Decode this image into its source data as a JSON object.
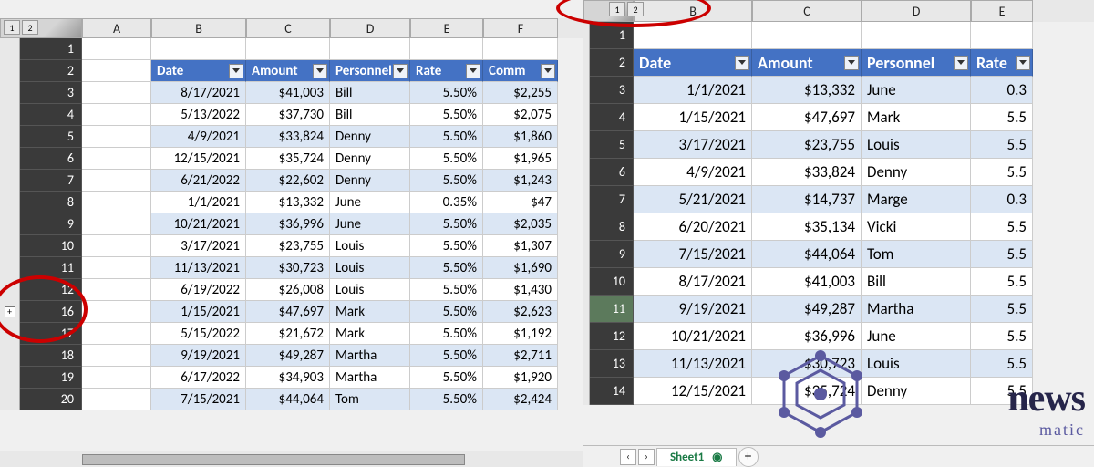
{
  "outline_levels": [
    "1",
    "2"
  ],
  "left": {
    "columns": [
      "A",
      "B",
      "C",
      "D",
      "E",
      "F"
    ],
    "row_numbers": [
      "1",
      "2",
      "3",
      "4",
      "5",
      "6",
      "7",
      "8",
      "9",
      "10",
      "11",
      "12",
      "16",
      "17",
      "18",
      "19",
      "20"
    ],
    "expand_row_index": 12,
    "headers": {
      "date": "Date",
      "amount": "Amount",
      "personnel": "Personnel",
      "rate": "Rate",
      "comm": "Comm"
    },
    "rows": [
      {
        "date": "8/17/2021",
        "amount": "$41,003",
        "personnel": "Bill",
        "rate": "5.50%",
        "comm": "$2,255"
      },
      {
        "date": "5/13/2022",
        "amount": "$37,730",
        "personnel": "Bill",
        "rate": "5.50%",
        "comm": "$2,075"
      },
      {
        "date": "4/9/2021",
        "amount": "$33,824",
        "personnel": "Denny",
        "rate": "5.50%",
        "comm": "$1,860"
      },
      {
        "date": "12/15/2021",
        "amount": "$35,724",
        "personnel": "Denny",
        "rate": "5.50%",
        "comm": "$1,965"
      },
      {
        "date": "6/21/2022",
        "amount": "$22,602",
        "personnel": "Denny",
        "rate": "5.50%",
        "comm": "$1,243"
      },
      {
        "date": "1/1/2021",
        "amount": "$13,332",
        "personnel": "June",
        "rate": "0.35%",
        "comm": "$47"
      },
      {
        "date": "10/21/2021",
        "amount": "$36,996",
        "personnel": "June",
        "rate": "5.50%",
        "comm": "$2,035"
      },
      {
        "date": "3/17/2021",
        "amount": "$23,755",
        "personnel": "Louis",
        "rate": "5.50%",
        "comm": "$1,307"
      },
      {
        "date": "11/13/2021",
        "amount": "$30,723",
        "personnel": "Louis",
        "rate": "5.50%",
        "comm": "$1,690"
      },
      {
        "date": "6/19/2022",
        "amount": "$26,008",
        "personnel": "Louis",
        "rate": "5.50%",
        "comm": "$1,430"
      },
      {
        "date": "1/15/2021",
        "amount": "$47,697",
        "personnel": "Mark",
        "rate": "5.50%",
        "comm": "$2,623"
      },
      {
        "date": "5/15/2022",
        "amount": "$21,672",
        "personnel": "Mark",
        "rate": "5.50%",
        "comm": "$1,192"
      },
      {
        "date": "9/19/2021",
        "amount": "$49,287",
        "personnel": "Martha",
        "rate": "5.50%",
        "comm": "$2,711"
      },
      {
        "date": "6/17/2022",
        "amount": "$34,903",
        "personnel": "Martha",
        "rate": "5.50%",
        "comm": "$1,920"
      },
      {
        "date": "7/15/2021",
        "amount": "$44,064",
        "personnel": "Tom",
        "rate": "5.50%",
        "comm": "$2,424"
      }
    ]
  },
  "right": {
    "columns": [
      "B",
      "C",
      "D",
      "E"
    ],
    "row_numbers": [
      "1",
      "2",
      "3",
      "4",
      "5",
      "6",
      "7",
      "8",
      "9",
      "10",
      "11",
      "12",
      "13",
      "14"
    ],
    "active_row": "11",
    "headers": {
      "date": "Date",
      "amount": "Amount",
      "personnel": "Personnel",
      "rate": "Rate"
    },
    "rows": [
      {
        "date": "1/1/2021",
        "amount": "$13,332",
        "personnel": "June",
        "rate": "0.3"
      },
      {
        "date": "1/15/2021",
        "amount": "$47,697",
        "personnel": "Mark",
        "rate": "5.5"
      },
      {
        "date": "3/17/2021",
        "amount": "$23,755",
        "personnel": "Louis",
        "rate": "5.5"
      },
      {
        "date": "4/9/2021",
        "amount": "$33,824",
        "personnel": "Denny",
        "rate": "5.5"
      },
      {
        "date": "5/21/2021",
        "amount": "$14,737",
        "personnel": "Marge",
        "rate": "0.3"
      },
      {
        "date": "6/20/2021",
        "amount": "$35,134",
        "personnel": "Vicki",
        "rate": "5.5"
      },
      {
        "date": "7/15/2021",
        "amount": "$44,064",
        "personnel": "Tom",
        "rate": "5.5"
      },
      {
        "date": "8/17/2021",
        "amount": "$41,003",
        "personnel": "Bill",
        "rate": "5.5"
      },
      {
        "date": "9/19/2021",
        "amount": "$49,287",
        "personnel": "Martha",
        "rate": "5.5"
      },
      {
        "date": "10/21/2021",
        "amount": "$36,996",
        "personnel": "June",
        "rate": "5.5"
      },
      {
        "date": "11/13/2021",
        "amount": "$30,723",
        "personnel": "Louis",
        "rate": "5.5"
      },
      {
        "date": "12/15/2021",
        "amount": "$35,724",
        "personnel": "Denny",
        "rate": "5.5"
      }
    ]
  },
  "tabs": {
    "sheet_name": "Sheet1"
  },
  "logo": {
    "line1": "news",
    "line2": "matic"
  },
  "icons": {
    "expand": "+",
    "nav_prev": "‹",
    "nav_next": "›",
    "add": "+"
  }
}
